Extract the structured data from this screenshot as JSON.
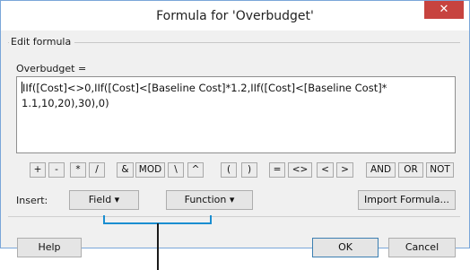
{
  "dialog": {
    "title": "Formula for 'Overbudget'",
    "close_glyph": "✕"
  },
  "group": {
    "label": "Edit formula",
    "field_label": "Overbudget ="
  },
  "formula": {
    "value": "IIf([Cost]<>0,IIf([Cost]<[Baseline Cost]*1.2,IIf([Cost]<[Baseline Cost]*\n1.1,10,20),30),0)"
  },
  "operators": [
    "+",
    "-",
    "*",
    "/",
    "&",
    "MOD",
    "\\",
    "^",
    "(",
    ")",
    "=",
    "<>",
    "<",
    ">",
    "AND",
    "OR",
    "NOT"
  ],
  "insert": {
    "label": "Insert:",
    "field_button": "Field ▾",
    "function_button": "Function ▾",
    "import_button": "Import Formula..."
  },
  "footer": {
    "help": "Help",
    "ok": "OK",
    "cancel": "Cancel"
  },
  "colors": {
    "close_button": "#c7433f",
    "callout": "#1a8ed1",
    "dialog_bg": "#f0f0f0"
  }
}
